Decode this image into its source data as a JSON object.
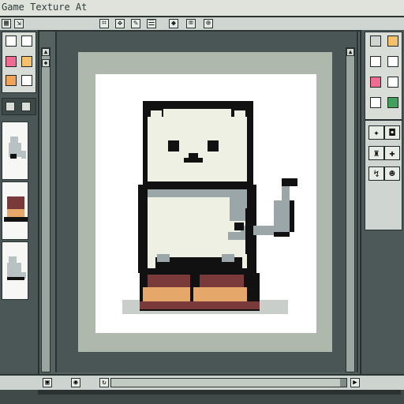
{
  "window": {
    "title": "Game Texture At"
  },
  "toolbar": {
    "icons": [
      {
        "name": "grid-icon",
        "glyph": "▦"
      },
      {
        "name": "expand-icon",
        "glyph": "⇲"
      },
      {
        "name": "select-icon",
        "glyph": "⌗"
      },
      {
        "name": "move-icon",
        "glyph": "✥"
      },
      {
        "name": "brush-icon",
        "glyph": "✎"
      },
      {
        "name": "layer-icon",
        "glyph": "☰"
      },
      {
        "name": "pin-icon",
        "glyph": "◆"
      },
      {
        "name": "crop-icon",
        "glyph": "⌧"
      },
      {
        "name": "zoom-icon",
        "glyph": "⊕"
      }
    ]
  },
  "left_panel": {
    "swatches": [
      {
        "color": "#ffffff"
      },
      {
        "color": "#ffffff"
      },
      {
        "color": "#f06b92"
      },
      {
        "color": "#f5c06a"
      },
      {
        "color": "#f2a35a"
      },
      {
        "color": "#ffffff"
      }
    ],
    "thumbnails": [
      {
        "name": "thumb-cat"
      },
      {
        "name": "thumb-boot"
      },
      {
        "name": "thumb-cat-2"
      }
    ]
  },
  "right_panel": {
    "swatches": [
      {
        "color": "#cfd6d1"
      },
      {
        "color": "#f5c06a"
      },
      {
        "color": "#ffffff"
      },
      {
        "color": "#ffffff"
      },
      {
        "color": "#f06b92"
      },
      {
        "color": "#ffffff"
      },
      {
        "color": "#ffffff"
      },
      {
        "color": "#42a05f"
      }
    ],
    "tools": [
      {
        "name": "sprite-tool-icon",
        "glyph": "✦"
      },
      {
        "name": "stamp-tool-icon",
        "glyph": "◘"
      },
      {
        "name": "bucket-tool-icon",
        "glyph": "♜"
      },
      {
        "name": "palette-tool-icon",
        "glyph": "✚"
      },
      {
        "name": "cursor-tool-icon",
        "glyph": "↯"
      },
      {
        "name": "face-tool-icon",
        "glyph": "☻"
      }
    ]
  },
  "statusbar": {
    "icons": [
      {
        "name": "image-icon",
        "glyph": "▣"
      },
      {
        "name": "camera-icon",
        "glyph": "◉"
      },
      {
        "name": "rotate-icon",
        "glyph": "↻"
      },
      {
        "name": "play-icon",
        "glyph": "▶"
      }
    ]
  },
  "colors": {
    "canvas_bg": "#aeb8ad",
    "paper": "#ffffff",
    "cat_fill": "#eef0e3",
    "cat_shade": "#9aa6a7",
    "outline": "#111111",
    "boot_light": "#e5a86a",
    "boot_dark": "#7a3a3a",
    "shadow": "#c9ceca"
  }
}
